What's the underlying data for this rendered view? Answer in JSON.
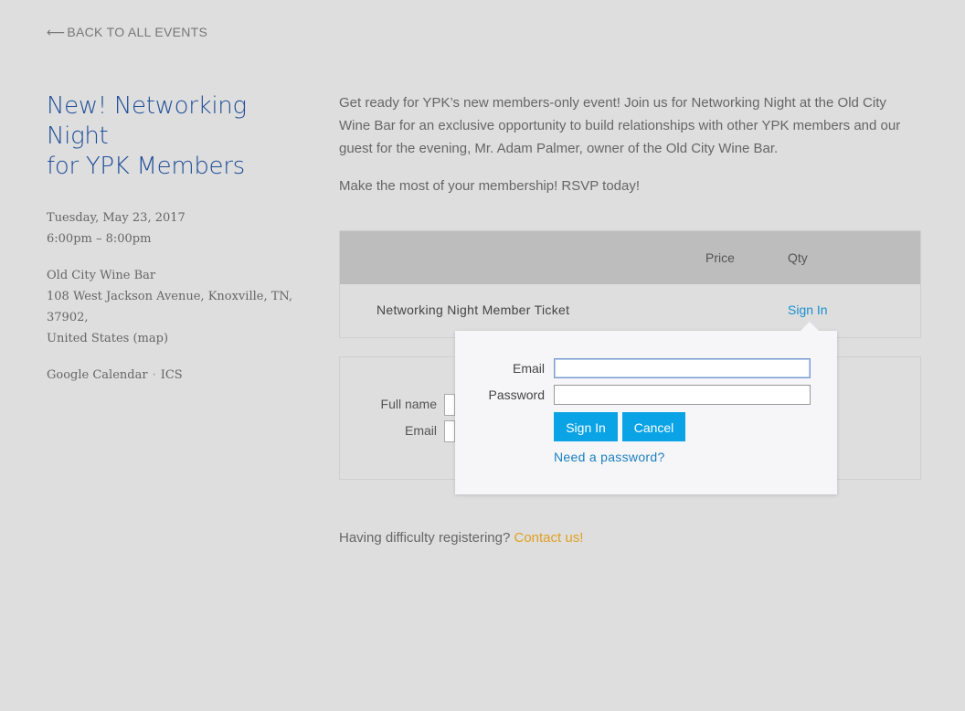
{
  "nav": {
    "back_arrow": "⟵",
    "back_label": "BACK TO ALL EVENTS"
  },
  "event": {
    "title_line1": "New! Networking Night",
    "title_line2": "for YPK Members",
    "date": "Tuesday, May 23, 2017",
    "time": "6:00pm – 8:00pm",
    "venue": "Old City Wine Bar",
    "address_line1": "108 West Jackson Avenue, Knoxville, TN, 37902,",
    "address_line2_prefix": "United States ",
    "map_link": "(map)",
    "calendar_links": [
      "Google Calendar",
      "ICS"
    ],
    "calendar_sep": "·"
  },
  "description": {
    "paragraph1": "Get ready for YPK’s new members-only event! Join us for Networking Night at the Old City Wine Bar for an exclusive opportunity to build relationships with other YPK members and our guest for the evening, Mr. Adam Palmer, owner of the Old City Wine Bar.",
    "paragraph2": "Make the most of your membership! RSVP today!"
  },
  "tickets": {
    "headers": {
      "price": "Price",
      "qty": "Qty"
    },
    "rows": [
      {
        "name": "Networking Night Member Ticket",
        "action": "Sign In"
      }
    ]
  },
  "registration": {
    "full_name_label": "Full name",
    "email_label": "Email"
  },
  "help": {
    "text": "Having difficulty registering?",
    "contact_link": "Contact us!"
  },
  "signin_popover": {
    "email_label": "Email",
    "password_label": "Password",
    "email_value": "",
    "password_value": "",
    "signin_button": "Sign In",
    "cancel_button": "Cancel",
    "need_password_link": "Need a password?"
  },
  "colors": {
    "title": "#1f4e99",
    "link": "#1a8fd0",
    "accent": "#e0a020",
    "button": "#0aa3e6",
    "table_header": "#bdbdbd"
  }
}
